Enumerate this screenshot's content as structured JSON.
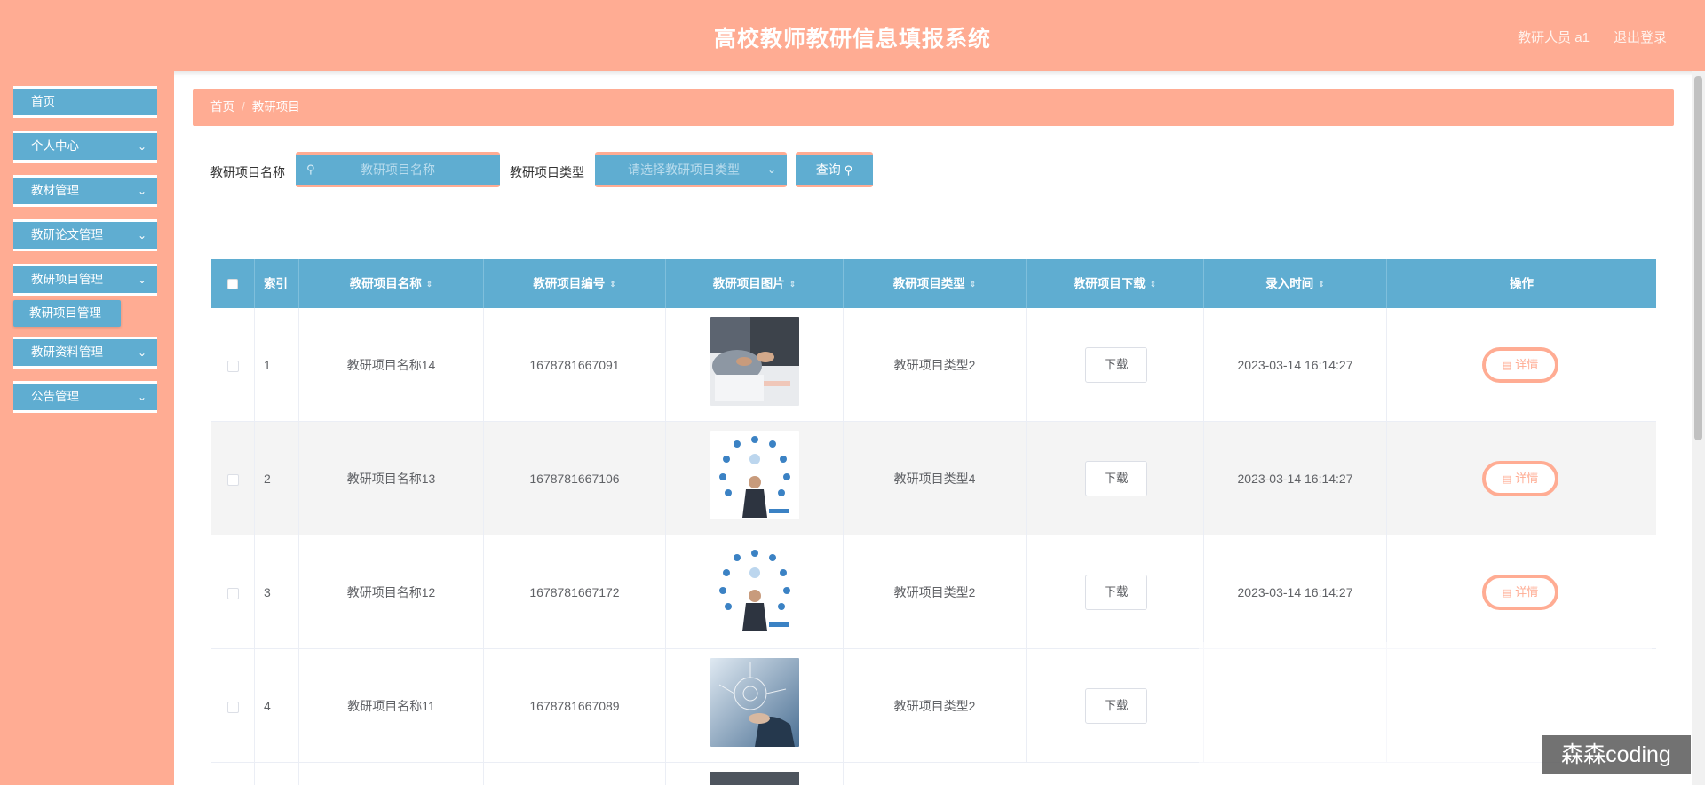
{
  "header": {
    "title": "高校教师教研信息填报系统",
    "user": "教研人员 a1",
    "logout": "退出登录"
  },
  "sidebar": {
    "items": [
      {
        "label": "首页",
        "has_chevron": false
      },
      {
        "label": "个人中心",
        "has_chevron": true
      },
      {
        "label": "教材管理",
        "has_chevron": true
      },
      {
        "label": "教研论文管理",
        "has_chevron": true
      },
      {
        "label": "教研项目管理",
        "has_chevron": true
      },
      {
        "label": "教研资料管理",
        "has_chevron": true
      },
      {
        "label": "公告管理",
        "has_chevron": true
      }
    ],
    "sub_item": "教研项目管理"
  },
  "breadcrumb": {
    "home": "首页",
    "current": "教研项目"
  },
  "search": {
    "name_label": "教研项目名称",
    "name_placeholder": "教研项目名称",
    "type_label": "教研项目类型",
    "type_placeholder": "请选择教研项目类型",
    "query_button": "查询"
  },
  "table": {
    "columns": [
      "索引",
      "教研项目名称",
      "教研项目编号",
      "教研项目图片",
      "教研项目类型",
      "教研项目下载",
      "录入时间",
      "操作"
    ],
    "rows": [
      {
        "index": "1",
        "name": "教研项目名称14",
        "code": "1678781667091",
        "image": "business-meeting",
        "type": "教研项目类型2",
        "download": "下载",
        "time": "2023-03-14 16:14:27",
        "action": "详情"
      },
      {
        "index": "2",
        "name": "教研项目名称13",
        "code": "1678781667106",
        "image": "network-person",
        "type": "教研项目类型4",
        "download": "下载",
        "time": "2023-03-14 16:14:27",
        "action": "详情"
      },
      {
        "index": "3",
        "name": "教研项目名称12",
        "code": "1678781667172",
        "image": "network-person",
        "type": "教研项目类型2",
        "download": "下载",
        "time": "2023-03-14 16:14:27",
        "action": "详情"
      },
      {
        "index": "4",
        "name": "教研项目名称11",
        "code": "1678781667089",
        "image": "tech-hand",
        "type": "教研项目类型2",
        "download": "下载",
        "time": "",
        "action": ""
      }
    ]
  },
  "watermark": "森森coding",
  "colors": {
    "salmon": "#ffac93",
    "blue": "#5fadd1"
  }
}
